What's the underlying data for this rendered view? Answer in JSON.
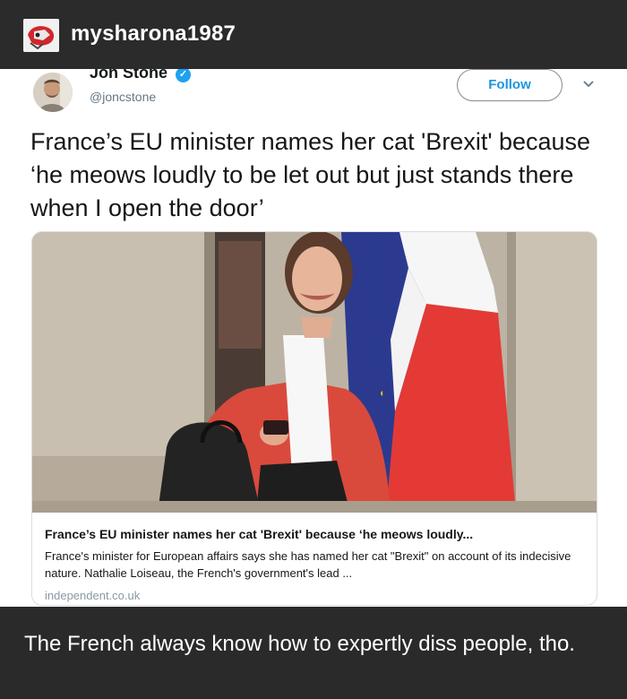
{
  "post": {
    "username": "mysharona1987",
    "caption": "The French always know how to expertly diss people, tho."
  },
  "tweet": {
    "author_name": "Jon Stone",
    "author_handle": "@joncstone",
    "follow_label": "Follow",
    "text": "France’s EU minister names her cat 'Brexit' because ‘he meows loudly to be let out but just stands there when I open the door’"
  },
  "link_card": {
    "title": "France’s EU minister names her cat 'Brexit' because ‘he meows loudly...",
    "description": "France's minister for European affairs says she has named her cat \"Brexit\" on account of its indecisive nature. Nathalie Loiseau, the French's government's lead ...",
    "domain": "independent.co.uk"
  },
  "icons": {
    "verified": "verified-badge-icon",
    "menu": "chevron-down-icon"
  },
  "colors": {
    "tumblr_bg": "#2b2b2b",
    "twitter_blue": "#1da1f2",
    "follow_text": "#1b95e0"
  }
}
